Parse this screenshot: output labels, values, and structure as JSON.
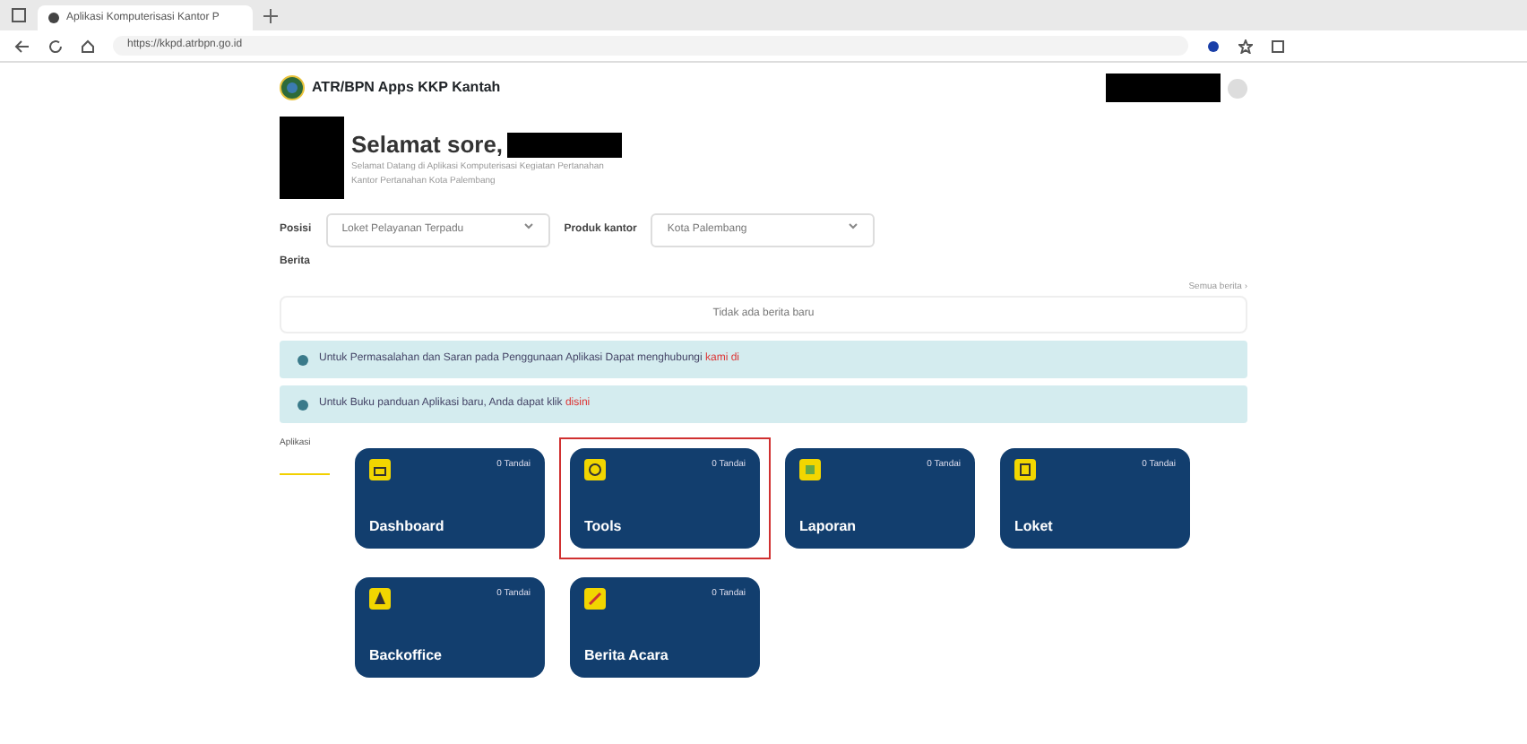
{
  "browser": {
    "tab_title": "Aplikasi Komputerisasi Kantor P",
    "address": "https://kkpd.atrbpn.go.id"
  },
  "header": {
    "app_name": "ATR/BPN Apps KKP Kantah",
    "redacted": true
  },
  "greeting": {
    "title": "Selamat sore,",
    "subtitle": [
      "Selamat Datang di Aplikasi Komputerisasi Kegiatan Pertanahan",
      "Kantor Pertanahan Kota Palembang"
    ]
  },
  "filters": [
    {
      "label": "Posisi",
      "value": "Loket Pelayanan Terpadu"
    },
    {
      "label": "Produk kantor",
      "value": "Kota Palembang"
    }
  ],
  "news": {
    "title": "Berita",
    "more_link": "Semua berita ›",
    "empty_text": "Tidak ada berita baru"
  },
  "alerts": [
    {
      "text": "Untuk Permasalahan dan Saran pada Penggunaan Aplikasi Dapat menghubungi ",
      "link": "kami di"
    },
    {
      "text": "Untuk Buku panduan Aplikasi baru, Anda dapat klik ",
      "link": "disini"
    }
  ],
  "apps_tab": {
    "label": "Aplikasi",
    "selected": true
  },
  "apps": [
    {
      "name": "Dashboard",
      "badge": "0 Tandai",
      "highlighted": false
    },
    {
      "name": "Tools",
      "badge": "0 Tandai",
      "highlighted": true
    },
    {
      "name": "Laporan",
      "badge": "0 Tandai",
      "highlighted": false
    },
    {
      "name": "Loket",
      "badge": "0 Tandai",
      "highlighted": false
    },
    {
      "name": "Backoffice",
      "badge": "0 Tandai",
      "highlighted": false
    },
    {
      "name": "Berita Acara",
      "badge": "0 Tandai",
      "highlighted": false
    }
  ]
}
